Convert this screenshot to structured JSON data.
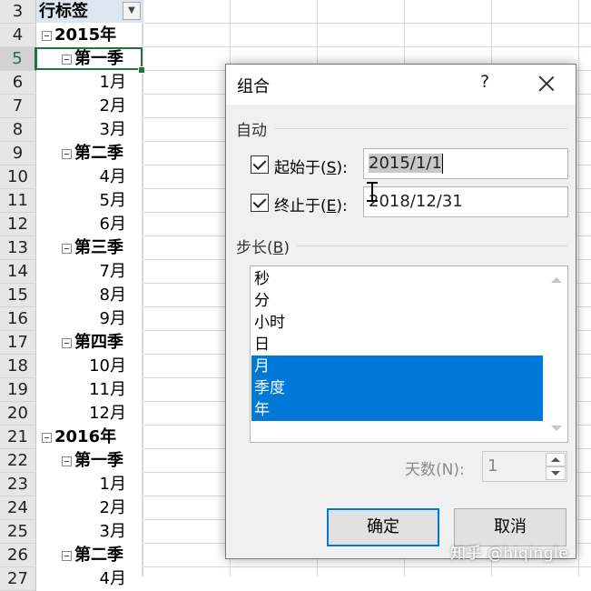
{
  "sheet": {
    "rows": [
      {
        "num": "3",
        "text": "行标签",
        "kind": "header"
      },
      {
        "num": "4",
        "text": "2015年",
        "kind": "year"
      },
      {
        "num": "5",
        "text": "第一季",
        "kind": "quarter",
        "active": true
      },
      {
        "num": "6",
        "text": "1月",
        "kind": "month"
      },
      {
        "num": "7",
        "text": "2月",
        "kind": "month"
      },
      {
        "num": "8",
        "text": "3月",
        "kind": "month"
      },
      {
        "num": "9",
        "text": "第二季",
        "kind": "quarter"
      },
      {
        "num": "10",
        "text": "4月",
        "kind": "month"
      },
      {
        "num": "11",
        "text": "5月",
        "kind": "month"
      },
      {
        "num": "12",
        "text": "6月",
        "kind": "month"
      },
      {
        "num": "13",
        "text": "第三季",
        "kind": "quarter"
      },
      {
        "num": "14",
        "text": "7月",
        "kind": "month"
      },
      {
        "num": "15",
        "text": "8月",
        "kind": "month"
      },
      {
        "num": "16",
        "text": "9月",
        "kind": "month"
      },
      {
        "num": "17",
        "text": "第四季",
        "kind": "quarter"
      },
      {
        "num": "18",
        "text": "10月",
        "kind": "month"
      },
      {
        "num": "19",
        "text": "11月",
        "kind": "month"
      },
      {
        "num": "20",
        "text": "12月",
        "kind": "month"
      },
      {
        "num": "21",
        "text": "2016年",
        "kind": "year"
      },
      {
        "num": "22",
        "text": "第一季",
        "kind": "quarter"
      },
      {
        "num": "23",
        "text": "1月",
        "kind": "month"
      },
      {
        "num": "24",
        "text": "2月",
        "kind": "month"
      },
      {
        "num": "25",
        "text": "3月",
        "kind": "month"
      },
      {
        "num": "26",
        "text": "第二季",
        "kind": "quarter"
      },
      {
        "num": "27",
        "text": "4月",
        "kind": "month"
      }
    ],
    "filter_icon": "dropdown-arrow-icon"
  },
  "dialog": {
    "title": "组合",
    "help_label": "?",
    "auto_section": "自动",
    "start_label_pre": "起始于(",
    "start_label_key": "S",
    "start_label_post": "):",
    "start_value": "2015/1/1",
    "end_label_pre": "终止于(",
    "end_label_key": "E",
    "end_label_post": "):",
    "end_value": "2018/12/31",
    "step_label_pre": "步长(",
    "step_label_key": "B",
    "step_label_post": ")",
    "step_items": [
      {
        "label": "秒",
        "selected": false
      },
      {
        "label": "分",
        "selected": false
      },
      {
        "label": "小时",
        "selected": false
      },
      {
        "label": "日",
        "selected": false
      },
      {
        "label": "月",
        "selected": true
      },
      {
        "label": "季度",
        "selected": true
      },
      {
        "label": "年",
        "selected": true
      }
    ],
    "days_label": "天数(N):",
    "days_value": "1",
    "ok_label": "确定",
    "cancel_label": "取消"
  },
  "watermark": "知乎 @hiqingle",
  "colors": {
    "selection_blue": "#0078d7",
    "excel_green": "#217346",
    "dialog_bg": "#f0f0f0"
  }
}
